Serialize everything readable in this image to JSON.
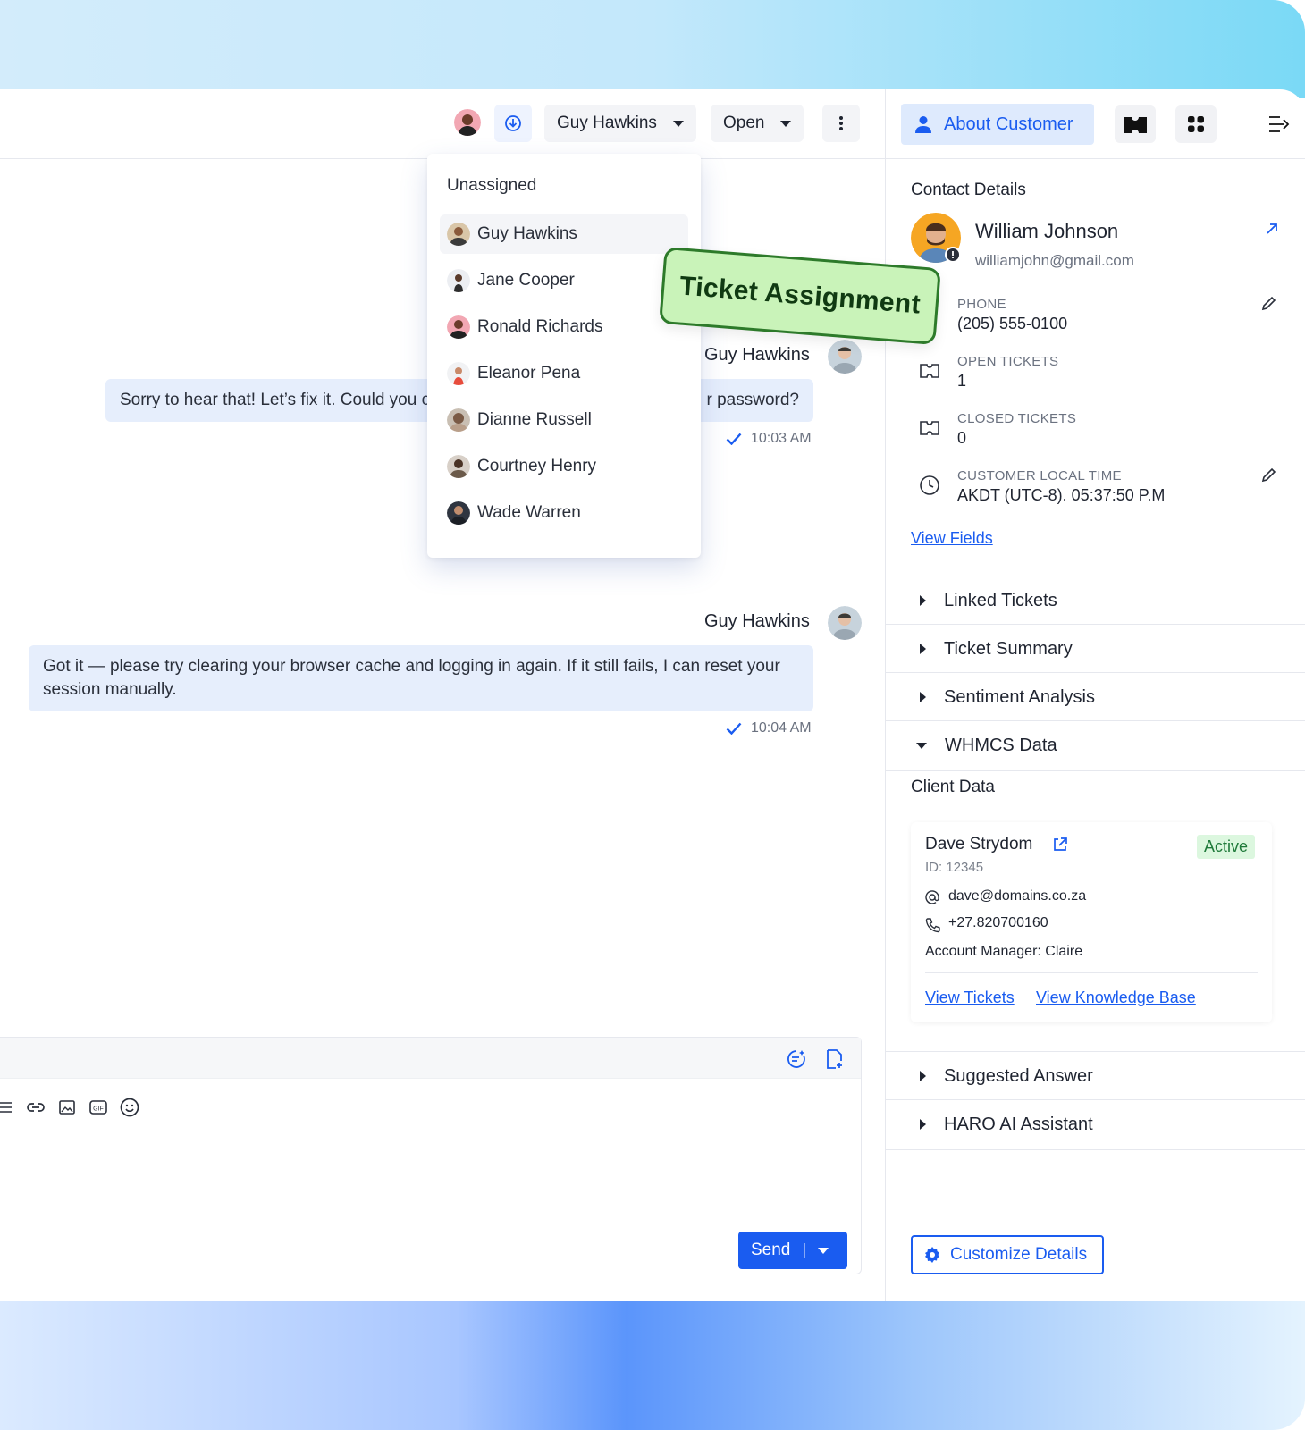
{
  "topbar": {
    "assignee_label": "Guy Hawkins",
    "status_label": "Open"
  },
  "dropdown": {
    "unassigned_label": "Unassigned",
    "agents": [
      {
        "name": "Guy Hawkins",
        "selected": true
      },
      {
        "name": "Jane Cooper"
      },
      {
        "name": "Ronald Richards"
      },
      {
        "name": "Eleanor Pena"
      },
      {
        "name": "Dianne Russell"
      },
      {
        "name": "Courtney Henry"
      },
      {
        "name": "Wade Warren"
      }
    ]
  },
  "sticker": {
    "text": "Ticket Assignment"
  },
  "messages": [
    {
      "sender": "Guy Hawkins",
      "text_left": "Sorry to hear that! Let’s fix it. Could you c",
      "text_right": "r password?",
      "time": "10:03 AM"
    },
    {
      "sender": "Guy Hawkins",
      "text": "Got it — please try clearing your browser cache and logging in again. If it still fails, I can reset your session manually.",
      "time": "10:04 AM"
    }
  ],
  "composer": {
    "send_label": "Send"
  },
  "right_panel": {
    "about_label": "About Customer",
    "contact_details_title": "Contact Details",
    "customer": {
      "name": "William Johnson",
      "email": "williamjohn@gmail.com",
      "phone_label": "PHONE",
      "phone": "(205) 555-0100",
      "open_tickets_label": "OPEN TICKETS",
      "open_tickets": "1",
      "closed_tickets_label": "CLOSED TICKETS",
      "closed_tickets": "0",
      "local_time_label": "CUSTOMER LOCAL TIME",
      "local_time": "AKDT (UTC-8). 05:37:50 P.M"
    },
    "view_fields": "View Fields",
    "sections": {
      "linked_tickets": "Linked Tickets",
      "ticket_summary": "Ticket Summary",
      "sentiment_analysis": "Sentiment Analysis",
      "whmcs_data": "WHMCS Data",
      "suggested_answer": "Suggested Answer",
      "haro_ai": "HARO AI Assistant"
    },
    "client_data": {
      "title": "Client Data",
      "name": "Dave Strydom",
      "id": "ID: 12345",
      "status": "Active",
      "email": "dave@domains.co.za",
      "phone": "+27.820700160",
      "account_manager": "Account Manager: Claire",
      "view_tickets": "View Tickets",
      "view_kb": "View Knowledge Base"
    },
    "customize_label": "Customize Details"
  },
  "colors": {
    "accent": "#1a5cf0",
    "bubble": "#e6eefc",
    "sticker_bg": "#c9f3b9",
    "sticker_border": "#2d7a2a",
    "active_badge": "#dcf7df"
  }
}
